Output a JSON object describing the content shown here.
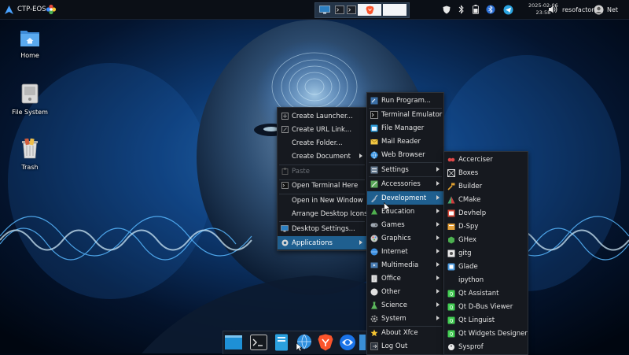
{
  "top_panel": {
    "title": "CTP-EOS",
    "datetime": {
      "date": "2025-02-06",
      "time": "23:58"
    },
    "username": "resofactor",
    "network_label": "Net"
  },
  "desktop": {
    "icons": [
      {
        "label": "Home"
      },
      {
        "label": "File System"
      },
      {
        "label": "Trash"
      }
    ]
  },
  "context_menu": {
    "items": [
      {
        "label": "Create Launcher..."
      },
      {
        "label": "Create URL Link..."
      },
      {
        "label": "Create Folder..."
      },
      {
        "label": "Create Document"
      },
      {
        "label": "Paste"
      },
      {
        "label": "Open Terminal Here"
      },
      {
        "label": "Open in New Window"
      },
      {
        "label": "Arrange Desktop Icons"
      },
      {
        "label": "Desktop Settings..."
      },
      {
        "label": "Applications"
      }
    ]
  },
  "applications_menu": {
    "items": [
      {
        "label": "Run Program..."
      },
      {
        "label": "Terminal Emulator"
      },
      {
        "label": "File Manager"
      },
      {
        "label": "Mail Reader"
      },
      {
        "label": "Web Browser"
      },
      {
        "label": "Settings"
      },
      {
        "label": "Accessories"
      },
      {
        "label": "Development"
      },
      {
        "label": "Education"
      },
      {
        "label": "Games"
      },
      {
        "label": "Graphics"
      },
      {
        "label": "Internet"
      },
      {
        "label": "Multimedia"
      },
      {
        "label": "Office"
      },
      {
        "label": "Other"
      },
      {
        "label": "Science"
      },
      {
        "label": "System"
      },
      {
        "label": "About Xfce"
      },
      {
        "label": "Log Out"
      }
    ]
  },
  "development_menu": {
    "items": [
      {
        "label": "Accerciser"
      },
      {
        "label": "Boxes"
      },
      {
        "label": "Builder"
      },
      {
        "label": "CMake"
      },
      {
        "label": "Devhelp"
      },
      {
        "label": "D-Spy"
      },
      {
        "label": "GHex"
      },
      {
        "label": "gitg"
      },
      {
        "label": "Glade"
      },
      {
        "label": "ipython"
      },
      {
        "label": "Qt Assistant"
      },
      {
        "label": "Qt D-Bus Viewer"
      },
      {
        "label": "Qt Linguist"
      },
      {
        "label": "Qt Widgets Designer"
      },
      {
        "label": "Sysprof"
      }
    ]
  },
  "colors": {
    "highlight": "#1f5f8f",
    "menu_bg": "#16191f",
    "panel_bg": "#0b0f16"
  }
}
